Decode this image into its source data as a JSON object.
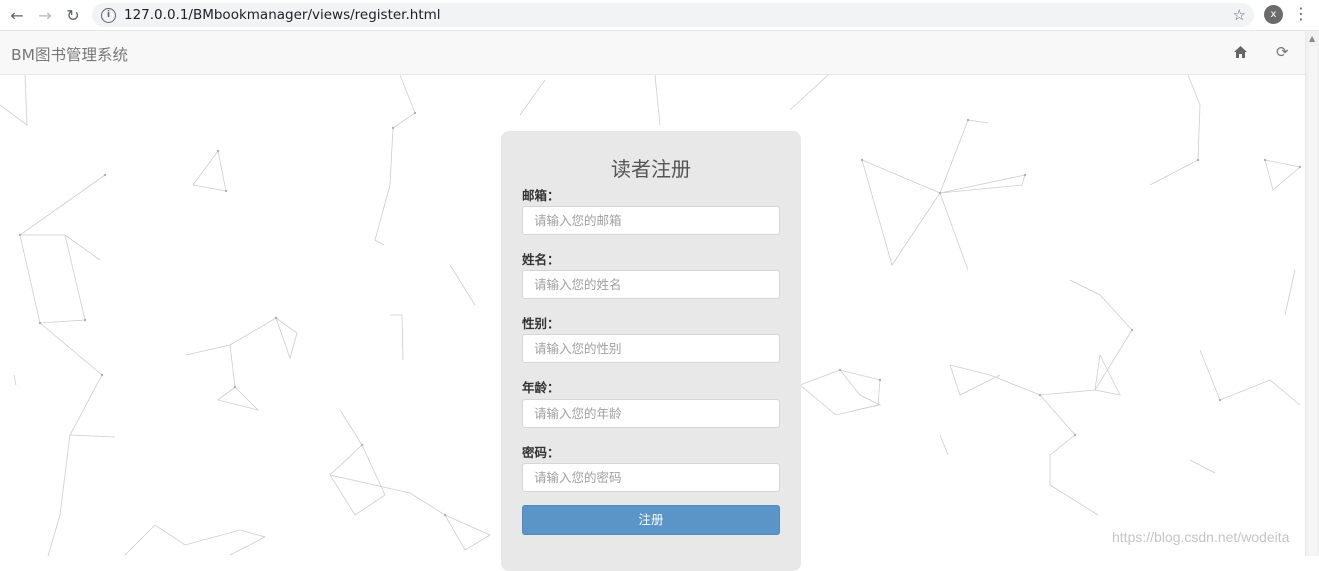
{
  "browser": {
    "url": "127.0.0.1/BMbookmanager/views/register.html",
    "profile_initial": "x"
  },
  "navbar": {
    "brand": "BM图书管理系统"
  },
  "form": {
    "title": "读者注册",
    "fields": [
      {
        "label": "邮箱：",
        "placeholder": "请输入您的邮箱"
      },
      {
        "label": "姓名：",
        "placeholder": "请输入您的姓名"
      },
      {
        "label": "性别：",
        "placeholder": "请输入您的性别"
      },
      {
        "label": "年龄：",
        "placeholder": "请输入您的年龄"
      },
      {
        "label": "密码：",
        "placeholder": "请输入您的密码"
      }
    ],
    "submit_label": "注册"
  },
  "watermark": "https://blog.csdn.net/wodeita",
  "colors": {
    "button": "#5b94c6",
    "card": "#e8e8e8",
    "navbar": "#f8f8f8"
  }
}
